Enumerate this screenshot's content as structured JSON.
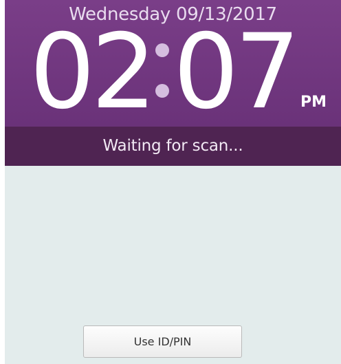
{
  "clock": {
    "date": "Wednesday 09/13/2017",
    "hours": "02",
    "minutes": "07",
    "ampm": "PM"
  },
  "status": {
    "text": "Waiting for scan..."
  },
  "actions": {
    "id_pin_label": "Use ID/PIN"
  },
  "colors": {
    "clock_panel": "#6f3680",
    "status_bar": "#4f2452",
    "body_background": "#e3ecec",
    "colon_dots": "#d5bedf"
  }
}
